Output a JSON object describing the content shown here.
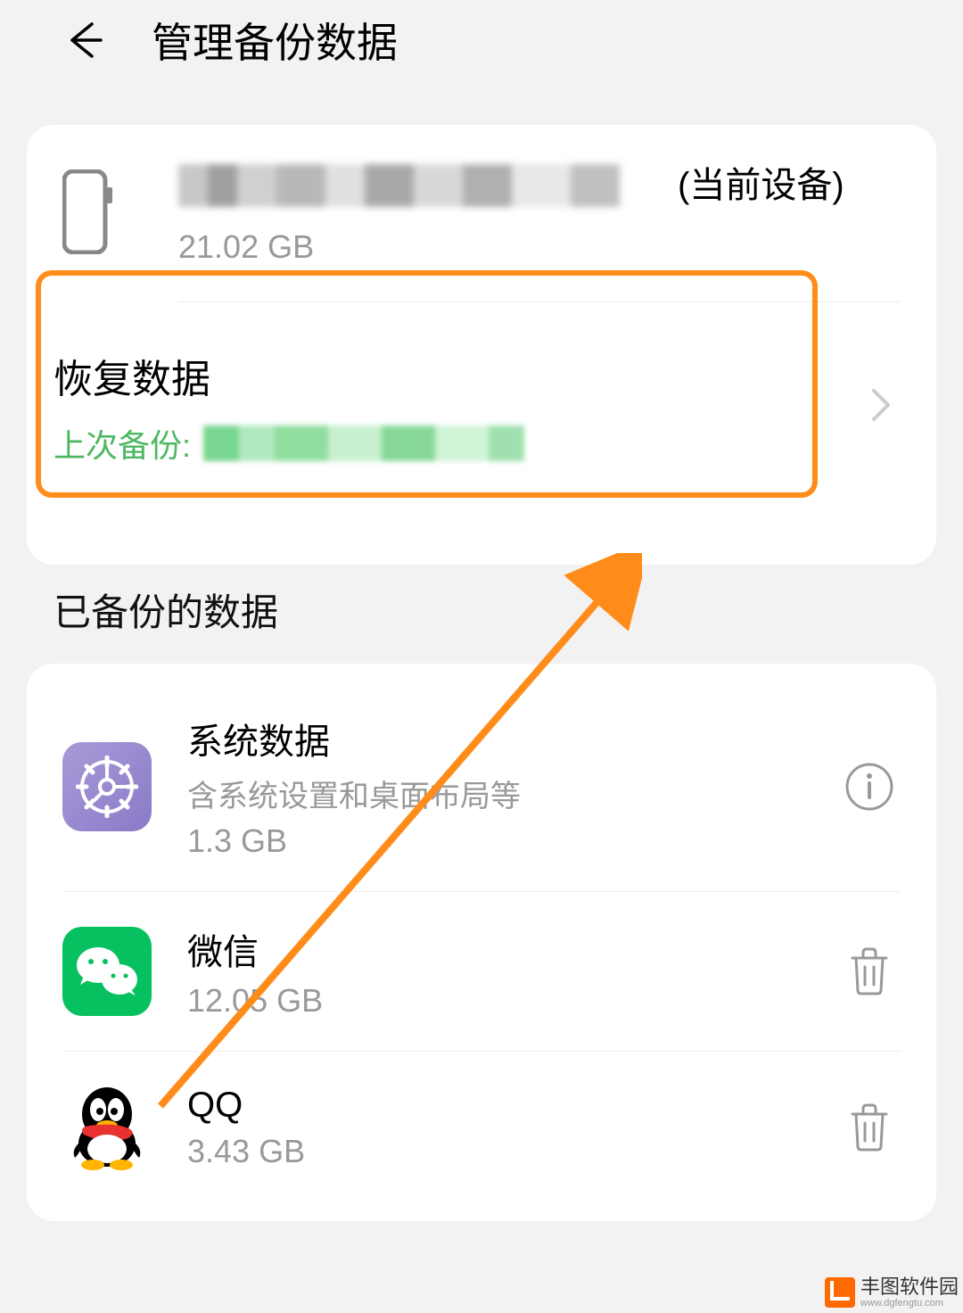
{
  "header": {
    "title": "管理备份数据"
  },
  "device": {
    "suffix": "(当前设备)",
    "size": "21.02 GB"
  },
  "restore": {
    "title": "恢复数据",
    "last_backup_label": "上次备份:"
  },
  "section": {
    "title": "已备份的数据"
  },
  "apps": {
    "system": {
      "title": "系统数据",
      "desc": "含系统设置和桌面布局等",
      "size": "1.3 GB"
    },
    "wechat": {
      "title": "微信",
      "size": "12.05 GB"
    },
    "qq": {
      "title": "QQ",
      "size": "3.43 GB"
    }
  },
  "watermark": {
    "name": "丰图软件园",
    "url": "www.dgfengtu.com"
  }
}
